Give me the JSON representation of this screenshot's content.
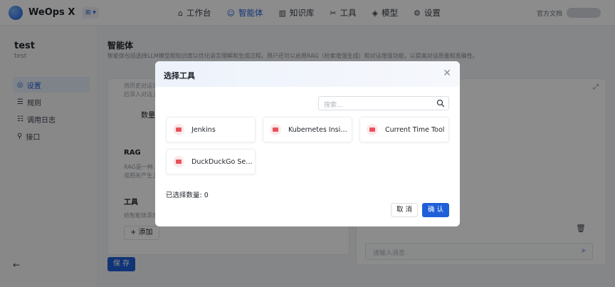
{
  "app": {
    "name": "WeOps X",
    "switch_label": "⊞ ▾"
  },
  "nav": {
    "items": [
      {
        "label": "工作台",
        "icon": "⌂"
      },
      {
        "label": "智能体",
        "icon": "☺"
      },
      {
        "label": "知识库",
        "icon": "▥"
      },
      {
        "label": "工具",
        "icon": "✂"
      },
      {
        "label": "模型",
        "icon": "◈"
      },
      {
        "label": "设置",
        "icon": "⚙"
      }
    ],
    "active": "智能体",
    "doc_link": "官方文档"
  },
  "agent": {
    "name": "test",
    "description": "test"
  },
  "side_menu": [
    {
      "label": "设置",
      "icon": "◎"
    },
    {
      "label": "规则",
      "icon": "☰"
    },
    {
      "label": "调用日志",
      "icon": "☷"
    },
    {
      "label": "接口",
      "icon": "⚲"
    }
  ],
  "main": {
    "title": "智能体",
    "description": "智能体包括选择LLM模型和知识库以优化语言理解和生成过程。用户还可以启用RAG（检索增强生成）和对话增强功能，以提高对话质量和准确性。"
  },
  "config": {
    "history_hint": "将历史对话添加到...",
    "history_hint2": "后添入对话上...",
    "count_label": "数量：",
    "rag_heading": "RAG",
    "rag_hint": "RAG是一种...",
    "rag_hint2": "成相关产生上...",
    "tools_heading": "工具",
    "tools_hint": "给智能体添加工具...",
    "add_button": "+ 添加",
    "save_button": "保 存"
  },
  "chat": {
    "placeholder": "请输入消息",
    "expand_icon": "⤢",
    "trash_icon": "🗑",
    "send_icon": "➤"
  },
  "modal": {
    "title": "选择工具",
    "search_placeholder": "搜索...",
    "tools": [
      {
        "label": "Jenkins"
      },
      {
        "label": "Kubernetes Insight ..."
      },
      {
        "label": "Current Time Tool"
      },
      {
        "label": "DuckDuckGo Search"
      }
    ],
    "selected_count_label": "已选择数量: 0",
    "cancel_label": "取 消",
    "ok_label": "确 认"
  },
  "colors": {
    "primary": "#1f5fd8",
    "tool_icon_bg": "#fde9ea",
    "tool_icon_fg": "#e8525c"
  }
}
